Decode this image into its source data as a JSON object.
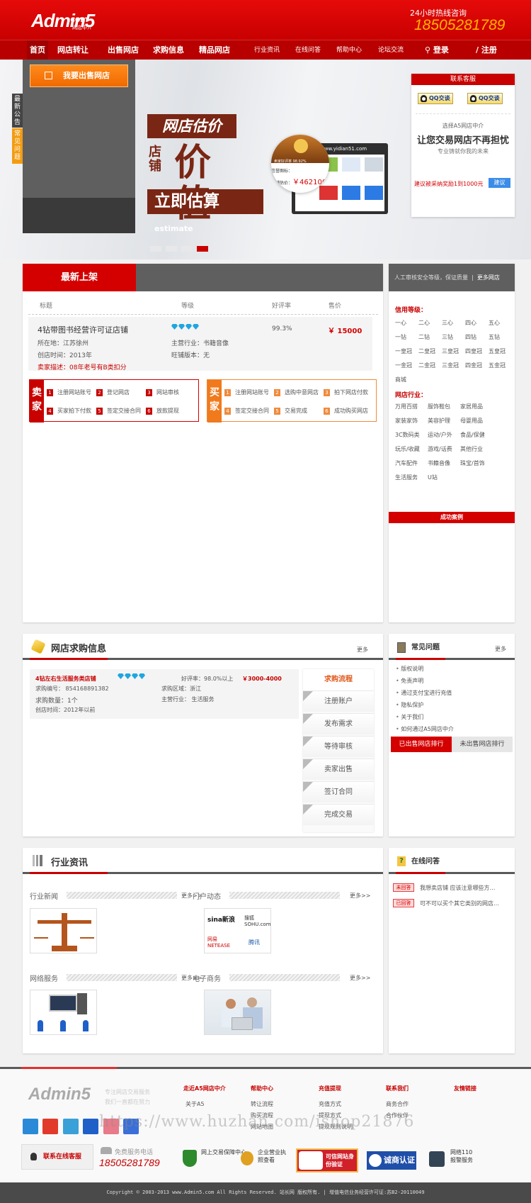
{
  "header": {
    "logo_text": "Admin5",
    "logo_domain": ".com",
    "logo_sub": "网店中介",
    "hotline_label": "24小时热线咨询",
    "hotline_number": "18505281789"
  },
  "nav": {
    "items": [
      {
        "label": "首页",
        "active": true
      },
      {
        "label": "网店转让"
      },
      {
        "label": "出售网店"
      },
      {
        "label": "求购信息"
      },
      {
        "label": "精品网店"
      },
      {
        "label": "行业资讯"
      },
      {
        "label": "在线问答"
      },
      {
        "label": "帮助中心"
      },
      {
        "label": "论坛交流"
      }
    ],
    "login": "登录",
    "register": "注册"
  },
  "banner": {
    "sell_button": "我要出售网店",
    "side_tabs": [
      "最新公告",
      "常见问题"
    ],
    "promo_line1": "网店估价",
    "promo_line2_small": "店铺",
    "promo_line2": "价值",
    "promo_line3": "立即估算",
    "promo_line3_en": "estimate",
    "screen_url": "www.yidian51.com",
    "magnifier_rating": "卖家好评率 98.92%",
    "magnifier_mark": "信誉图标：",
    "magnifier_price_label": "店铺估价：",
    "magnifier_price": "￥462100",
    "slide_count": 4,
    "active_slide": 4
  },
  "contact": {
    "title": "联系客服",
    "qq_buttons": [
      "QQ交谈",
      "QQ交谈"
    ],
    "line1": "选择A5网店中介",
    "line2": "让您交易网店不再担忧",
    "line3": "专业铸就你我的未来",
    "suggest_text": "建议被采纳奖励1到1000元",
    "suggest_button": "建议"
  },
  "newest": {
    "tab": "最新上架",
    "columns": [
      "标题",
      "等级",
      "好评率",
      "售价"
    ],
    "listing": {
      "title": "4钻带图书经营许可证店铺",
      "location": "所在地：江苏徐州",
      "created": "创店时间：2013年",
      "description": "卖家描述：08年老号有B类扣分",
      "level_diamonds": 4,
      "industry": "主营行业：书籍音像",
      "edition": "旺铺版本：无",
      "rating": "99.3%",
      "price": "￥ 15000"
    },
    "seller_flow": {
      "label": "卖家",
      "steps": [
        "注册网站账号",
        "登记网店",
        "网站审核",
        "买家拍下付款",
        "签定交接合同",
        "放款提现"
      ]
    },
    "buyer_flow": {
      "label": "买家",
      "steps": [
        "注册网站账号",
        "选购中意网店",
        "拍下网店付款",
        "签定交接合同",
        "交易完成",
        "成功购买网店"
      ]
    }
  },
  "filter": {
    "top_text": "人工审核安全等级，保证质量",
    "more_shops": "更多网店",
    "credit_heading": "信用等级：",
    "credit_levels": [
      [
        "一心",
        "二心",
        "三心",
        "四心",
        "五心"
      ],
      [
        "一钻",
        "二钻",
        "三钻",
        "四钻",
        "五钻"
      ],
      [
        "一皇冠",
        "二皇冠",
        "三皇冠",
        "四皇冠",
        "五皇冠"
      ],
      [
        "一金冠",
        "二金冠",
        "三金冠",
        "四金冠",
        "五金冠"
      ],
      [
        "商城"
      ]
    ],
    "industry_heading": "网店行业：",
    "industries": [
      [
        "万用百搭",
        "服饰鞋包",
        "家居用品"
      ],
      [
        "家装家饰",
        "美容护理",
        "母婴用品"
      ],
      [
        "3C数码类",
        "运动/户外",
        "食品/保健"
      ],
      [
        "玩乐/收藏",
        "游戏/话费",
        "其他行业"
      ],
      [
        "汽车配件",
        "书籍音像",
        "珠宝/首饰"
      ],
      [
        "生活服务",
        "U站"
      ]
    ],
    "success_cases": "成功案例"
  },
  "buyinfo": {
    "title": "网店求购信息",
    "more": "更多",
    "card": {
      "title": "4钻左右生活服务类店铺",
      "level_diamonds": 4,
      "rating": "好评率：98.0%以上",
      "price": "￥3000-4000",
      "number": "求购编号：  854168891382",
      "region": "求购区域：浙江",
      "quantity": "求购数量：1个",
      "industry": "主营行业：  生活服务",
      "created": "创店时间：2012年以前"
    },
    "process_title": "求购流程",
    "process_steps": [
      "注册账户",
      "发布需求",
      "等待审核",
      "卖家出售",
      "签订合同",
      "完成交易"
    ]
  },
  "faq": {
    "title": "常见问题",
    "more": "更多",
    "items": [
      "版权说明",
      "免责声明",
      "通过支付宝进行充值",
      "隐私保护",
      "关于我们",
      "如何通过A5网店中介"
    ],
    "tab_sold": "已出售网店排行",
    "tab_unsold": "未出售网店排行"
  },
  "news": {
    "title": "行业资讯",
    "columns": [
      {
        "title": "行业新闻",
        "more": "更多>>"
      },
      {
        "title": "门户动态",
        "more": "更多>>"
      },
      {
        "title": "网络服务",
        "more": "更多>>"
      },
      {
        "title": "电子商务",
        "more": "更多>>"
      }
    ],
    "portal_logos": [
      "sina新浪",
      "搜狐 SOHU.com",
      "网易 NETEASE",
      "腾讯"
    ]
  },
  "qa": {
    "title": "在线问答",
    "items": [
      {
        "tag": "未回答",
        "text": "我想卖店铺 应该注意哪些方…"
      },
      {
        "tag": "已回答",
        "text": "可不可以买个其它类别的网店…"
      }
    ]
  },
  "footer": {
    "logo_text": "Admin5",
    "slogan": [
      "专注网店交易服务",
      "我们一直都在努力"
    ],
    "columns": [
      {
        "title": "走近A5网店中介",
        "items": [
          "关于A5"
        ]
      },
      {
        "title": "帮助中心",
        "items": [
          "转让流程",
          "购买流程",
          "网站地图"
        ]
      },
      {
        "title": "充值提现",
        "items": [
          "充值方式",
          "提现方式",
          "提现规则说明"
        ]
      },
      {
        "title": "联系我们",
        "items": [
          "商务合作",
          "合作伙伴"
        ]
      },
      {
        "title": "友情链接",
        "items": []
      }
    ],
    "online_service": "联系在线客服",
    "free_phone_label": "免费服务电话",
    "free_phone": "18505281789",
    "badges": [
      "网上交易保障中心",
      "企业营业执照查看",
      "可信网站身份验证",
      "诚商认证",
      "网络110报警服务"
    ],
    "copyright": "Copyright © 2003-2013 www.Admin5.com All Rights Reserved. 站长网 版权所有.",
    "license": "| 增值电信业务经营许可证:苏B2-20110049",
    "watermark": "https://www.huzhan.com/ishop21876"
  },
  "colors": {
    "brand_red": "#c80000",
    "accent_orange": "#f07a1c",
    "hotline_yellow": "#ffb400",
    "diamond_blue": "#1fa6e0"
  }
}
